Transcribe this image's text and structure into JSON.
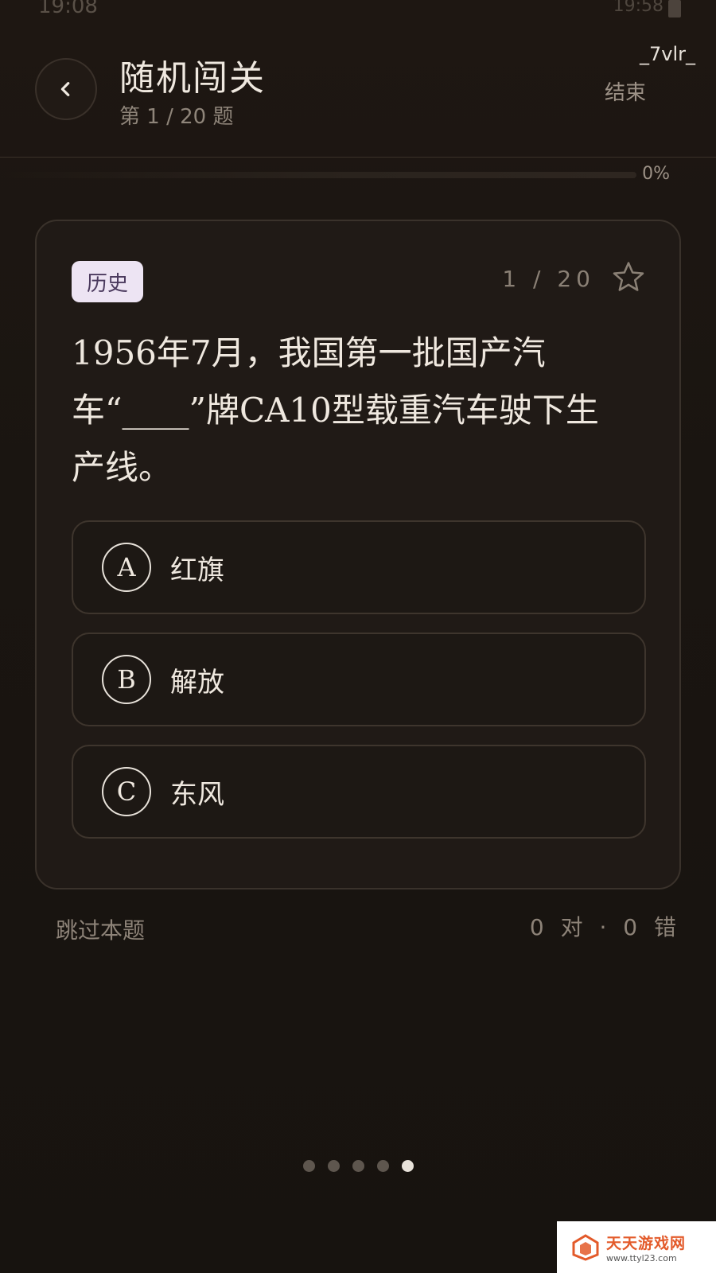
{
  "status_bar": {
    "time": "19:08",
    "right_text": "19:58"
  },
  "header": {
    "title": "随机闯关",
    "subtitle": "第 1 / 20 题",
    "username": "_7vlr_",
    "end_label": "结束"
  },
  "progress": {
    "percent_label": "0%",
    "value": 0
  },
  "card": {
    "category": "历史",
    "counter": "1 / 20",
    "question": "1956年7月，我国第一批国产汽车“____”牌CA10型载重汽车驶下生产线。",
    "options": [
      {
        "letter": "A",
        "text": "红旗"
      },
      {
        "letter": "B",
        "text": "解放"
      },
      {
        "letter": "C",
        "text": "东风"
      }
    ]
  },
  "footer": {
    "skip_label": "跳过本题",
    "score": "0 对 · 0 错"
  },
  "pager": {
    "count": 5,
    "active_index": 4
  },
  "watermark": {
    "title": "天天游戏网",
    "url": "www.ttyl23.com"
  },
  "colors": {
    "accent": "#c9a66b",
    "background": "#1a1511",
    "badge_bg": "#ede4f3"
  }
}
